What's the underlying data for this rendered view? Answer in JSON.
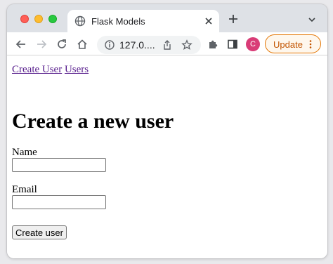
{
  "browser": {
    "tab": {
      "title": "Flask Models"
    },
    "address": {
      "url": "127.0...."
    },
    "profile": {
      "initial": "C"
    },
    "update_label": "Update",
    "accent": "#e37400",
    "profile_color": "#d93c77"
  },
  "page": {
    "nav": {
      "create_user": "Create User",
      "users": "Users"
    },
    "heading": "Create a new user",
    "form": {
      "name_label": "Name",
      "name_value": "",
      "email_label": "Email",
      "email_value": "",
      "submit_label": "Create user"
    }
  }
}
